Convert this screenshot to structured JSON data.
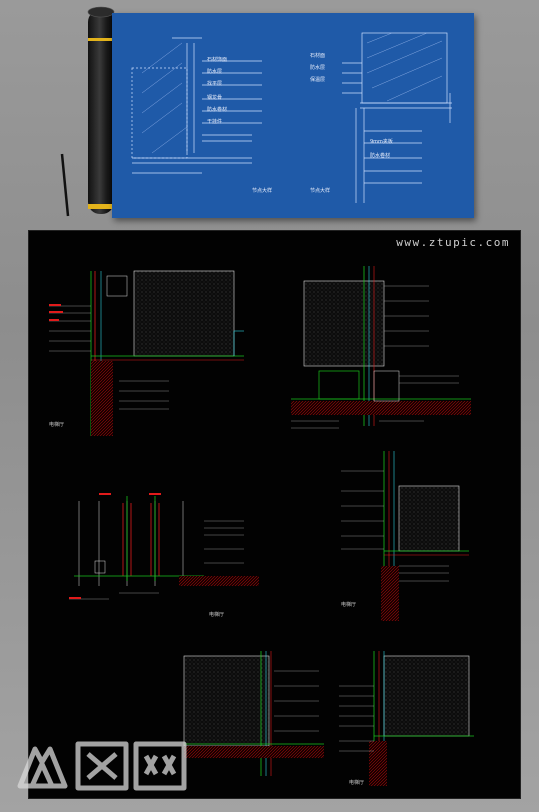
{
  "watermark": {
    "site": "www.ztupic.com"
  },
  "logo": {
    "text": "众图网"
  },
  "blueprint": {
    "labels_left": [
      "石材饰面",
      "防水层",
      "找平层",
      "钢龙骨",
      "防水卷材",
      "干挂件"
    ],
    "labels_right": [
      "石材面",
      "防水层",
      "保温层",
      "9mm夹板",
      "防水卷材"
    ],
    "caption_left": "节点大样",
    "caption_right": "节点大样"
  },
  "drawings": {
    "label_1": "电梯厅",
    "label_2": "电梯厅",
    "label_3": "电梯厅",
    "label_4": "电梯厅"
  },
  "colors": {
    "blueprint_bg": "#1f5aa8",
    "sheet_bg": "#020202",
    "line_green": "#19c21c",
    "line_red": "#e11b1b",
    "line_cyan": "#2fd3e0",
    "line_white": "#e6e6e6",
    "hatch": "#7a7a7a"
  }
}
